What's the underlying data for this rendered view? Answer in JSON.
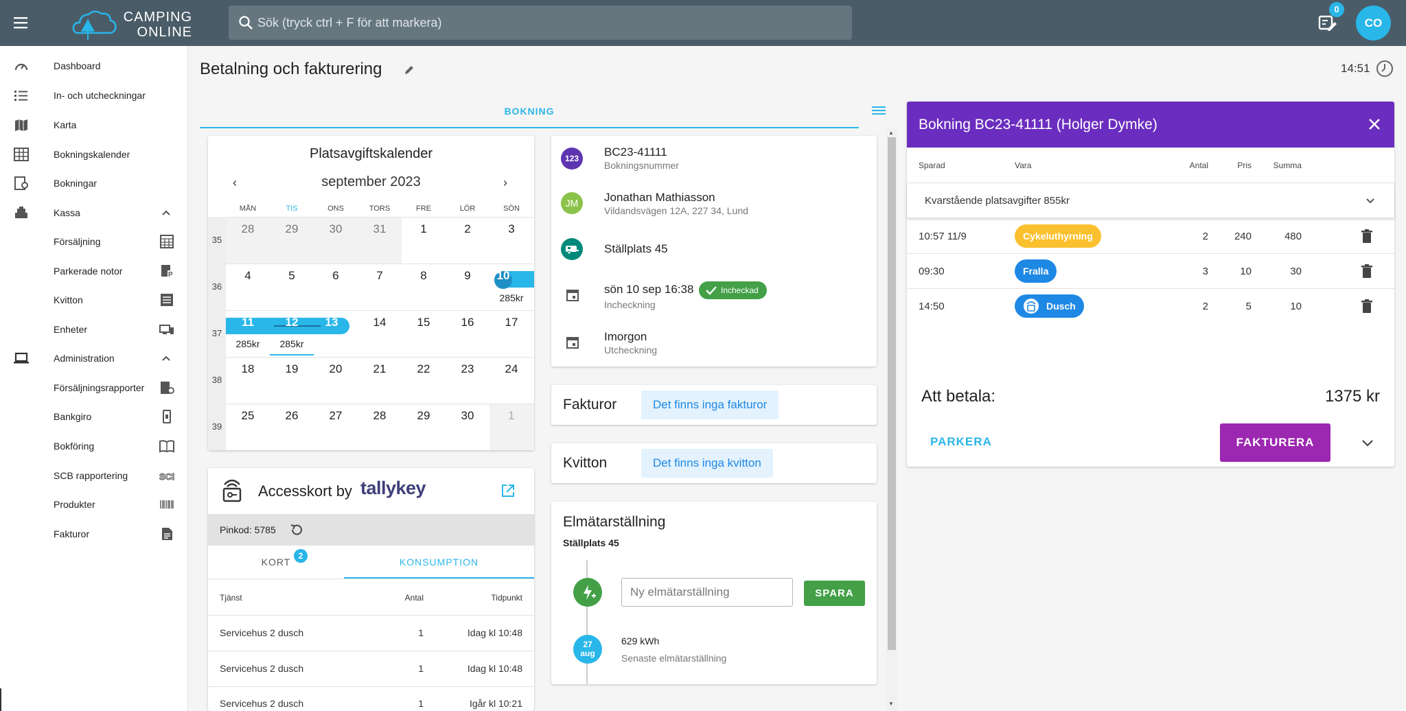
{
  "topbar": {
    "logo_line1": "CAMPING",
    "logo_line2": "ONLINE",
    "search_placeholder": "Sök (tryck ctrl + F för att markera)",
    "notes_count": "0",
    "avatar_initials": "CO"
  },
  "sidebar": {
    "items": [
      {
        "label": "Dashboard"
      },
      {
        "label": "In- och utcheckningar"
      },
      {
        "label": "Karta"
      },
      {
        "label": "Bokningskalender"
      },
      {
        "label": "Bokningar"
      },
      {
        "label": "Kassa"
      },
      {
        "label": "Försäljning"
      },
      {
        "label": "Parkerade notor"
      },
      {
        "label": "Kvitton"
      },
      {
        "label": "Enheter"
      },
      {
        "label": "Administration"
      },
      {
        "label": "Försäljningsrapporter"
      },
      {
        "label": "Bankgiro"
      },
      {
        "label": "Bokföring"
      },
      {
        "label": "SCB rapportering"
      },
      {
        "label": "Produkter"
      },
      {
        "label": "Fakturor"
      }
    ]
  },
  "page": {
    "title": "Betalning och fakturering",
    "time": "14:51",
    "tab_label": "BOKNING"
  },
  "calendar": {
    "title": "Platsavgiftskalender",
    "month": "september 2023",
    "prev": "‹",
    "next": "›",
    "weekdays": [
      "MÅN",
      "TIS",
      "ONS",
      "TORS",
      "FRE",
      "LÖR",
      "SÖN"
    ],
    "weeks": [
      {
        "week": "35",
        "days": [
          "28",
          "29",
          "30",
          "31",
          "1",
          "2",
          "3"
        ]
      },
      {
        "week": "36",
        "days": [
          "4",
          "5",
          "6",
          "7",
          "8",
          "9",
          "10"
        ]
      },
      {
        "week": "37",
        "days": [
          "11",
          "12",
          "13",
          "14",
          "15",
          "16",
          "17"
        ]
      },
      {
        "week": "38",
        "days": [
          "18",
          "19",
          "20",
          "21",
          "22",
          "23",
          "24"
        ]
      },
      {
        "week": "39",
        "days": [
          "25",
          "26",
          "27",
          "28",
          "29",
          "30",
          "1"
        ]
      }
    ],
    "prices": {
      "sun10": "285kr",
      "mon11": "285kr",
      "tue12": "285kr"
    }
  },
  "access": {
    "title": "Accesskort by",
    "brand": "tallykey",
    "pin": "Pinkod: 5785",
    "tab_kort": "KORT",
    "tab_kort_badge": "2",
    "tab_konsumption": "KONSUMPTION",
    "headers": {
      "service": "Tjänst",
      "count": "Antal",
      "time": "Tidpunkt"
    },
    "rows": [
      {
        "service": "Servicehus 2 dusch",
        "count": "1",
        "time": "Idag kl 10:48"
      },
      {
        "service": "Servicehus 2 dusch",
        "count": "1",
        "time": "Idag kl 10:48"
      },
      {
        "service": "Servicehus 2 dusch",
        "count": "1",
        "time": "Igår kl 10:21"
      }
    ]
  },
  "booking_info": {
    "booking_no": "BC23-41111",
    "booking_no_label": "Bokningsnummer",
    "booking_icon_text": "123",
    "guest_initials": "JM",
    "guest_name": "Jonathan Mathiasson",
    "guest_address": "Vildandsvägen 12A, 227 34, Lund",
    "place": "Ställplats 45",
    "checkin": "sön 10 sep 16:38",
    "checkin_label": "Incheckning",
    "checkin_status": "Incheckad",
    "checkout": "Imorgon",
    "checkout_label": "Utcheckning"
  },
  "invoices": {
    "title": "Fakturor",
    "empty": "Det finns inga fakturor"
  },
  "receipts": {
    "title": "Kvitton",
    "empty": "Det finns inga kvitton"
  },
  "meter": {
    "title": "Elmätarställning",
    "place": "Ställplats 45",
    "placeholder": "Ny elmätarställning",
    "save": "SPARA",
    "date_day": "27",
    "date_month": "aug",
    "kwh": "629 kWh",
    "last_label": "Senaste elmätarställning"
  },
  "booking_panel": {
    "title": "Bokning BC23-41111 (Holger Dymke)",
    "headers": {
      "saved": "Sparad",
      "item": "Vara",
      "qty": "Antal",
      "price": "Pris",
      "sum": "Summa"
    },
    "remaining": "Kvarstående platsavgifter  855kr",
    "rows": [
      {
        "saved": "10:57 11/9",
        "item": "Cykeluthyrning",
        "qty": "2",
        "price": "240",
        "sum": "480",
        "color": "#fbc02d"
      },
      {
        "saved": "09:30",
        "item": "Fralla",
        "qty": "3",
        "price": "10",
        "sum": "30",
        "color": "#1e88e5"
      },
      {
        "saved": "14:50",
        "item": "Dusch",
        "qty": "2",
        "price": "5",
        "sum": "10",
        "color": "#1e88e5"
      }
    ],
    "to_pay_label": "Att betala:",
    "to_pay_amount": "1375 kr",
    "park": "PARKERA",
    "invoice": "FAKTURERA"
  },
  "colors": {
    "topbar": "#4a5c68",
    "accent": "#29b6e8",
    "purple": "#6b2dbf",
    "invoice_btn": "#9c27b0",
    "green": "#43a047"
  }
}
